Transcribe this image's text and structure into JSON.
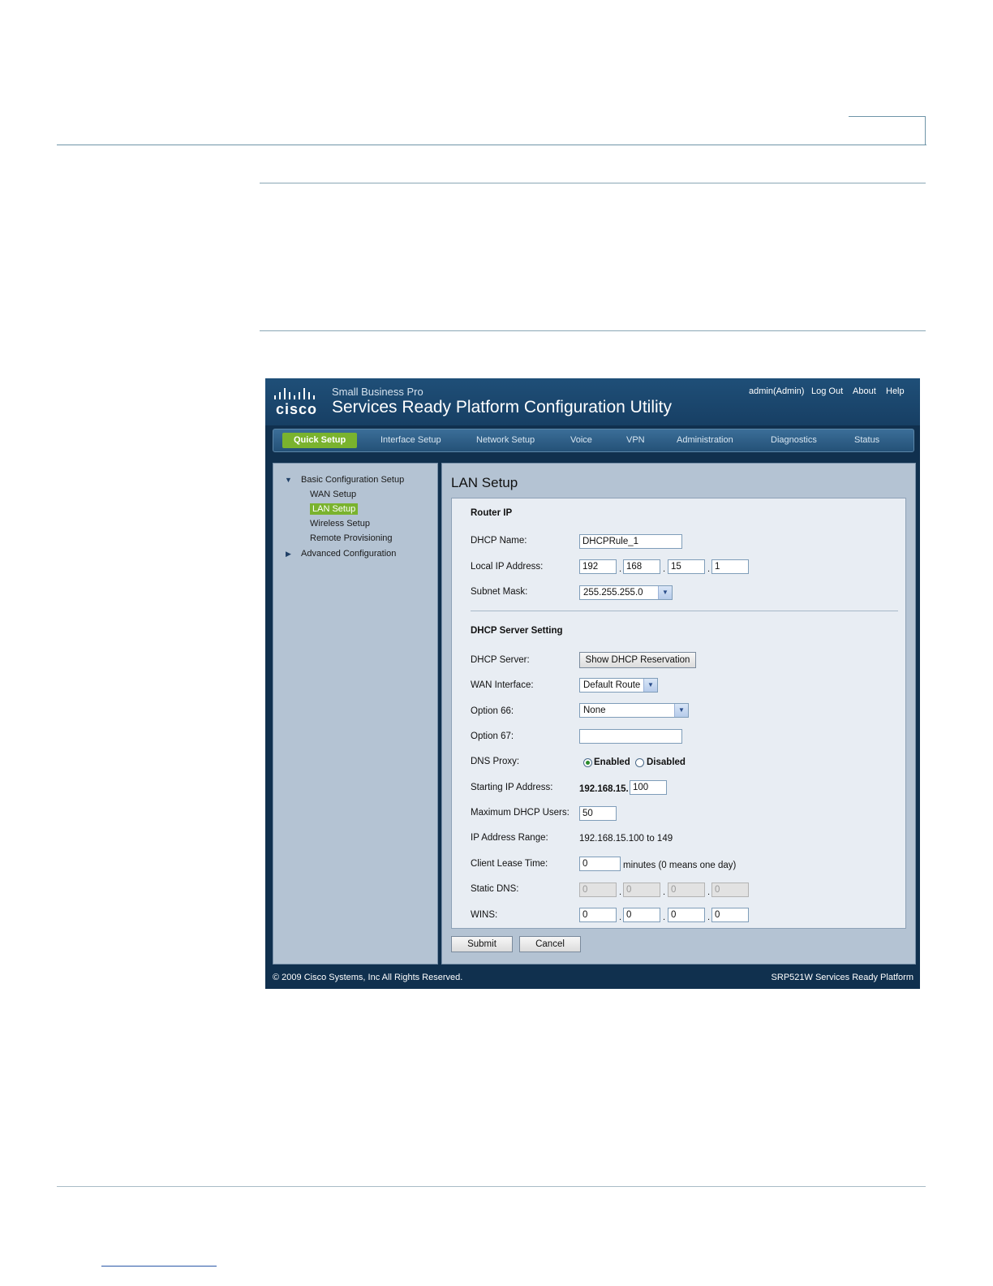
{
  "header_logo": "cisco",
  "header_subtitle": "Small Business Pro",
  "header_title": "Services Ready Platform Configuration Utility",
  "top_links": {
    "user": "admin(Admin)",
    "logout": "Log Out",
    "about": "About",
    "help": "Help"
  },
  "nav": [
    {
      "label": "Quick Setup",
      "active": true
    },
    {
      "label": "Interface Setup"
    },
    {
      "label": "Network Setup"
    },
    {
      "label": "Voice"
    },
    {
      "label": "VPN"
    },
    {
      "label": "Administration"
    },
    {
      "label": "Diagnostics"
    },
    {
      "label": "Status"
    }
  ],
  "sidebar": {
    "basic": "Basic Configuration Setup",
    "items": [
      "WAN Setup",
      "LAN Setup",
      "Wireless Setup",
      "Remote Provisioning"
    ],
    "advanced": "Advanced Configuration"
  },
  "page_title": "LAN Setup",
  "router_ip": {
    "heading": "Router IP",
    "dhcp_name_label": "DHCP Name:",
    "dhcp_name_value": "DHCPRule_1",
    "local_ip_label": "Local IP Address:",
    "local_ip": [
      "192",
      "168",
      "15",
      "1"
    ],
    "subnet_label": "Subnet Mask:",
    "subnet_value": "255.255.255.0"
  },
  "dhcp": {
    "heading": "DHCP Server Setting",
    "server_label": "DHCP Server:",
    "show_reservation_button": "Show DHCP Reservation",
    "wan_label": "WAN Interface:",
    "wan_value": "Default Route",
    "opt66_label": "Option 66:",
    "opt66_value": "None",
    "opt67_label": "Option 67:",
    "opt67_value": "",
    "dns_proxy_label": "DNS Proxy:",
    "dns_enabled": "Enabled",
    "dns_disabled": "Disabled",
    "start_ip_label": "Starting IP Address:",
    "start_ip_prefix": "192.168.15.",
    "start_ip_value": "100",
    "max_users_label": "Maximum DHCP Users:",
    "max_users_value": "50",
    "range_label": "IP Address Range:",
    "range_value": "192.168.15.100 to 149",
    "lease_label": "Client Lease Time:",
    "lease_value": "0",
    "lease_note": "minutes (0 means one day)",
    "static_dns_label": "Static DNS:",
    "static_dns": [
      "0",
      "0",
      "0",
      "0"
    ],
    "wins_label": "WINS:",
    "wins": [
      "0",
      "0",
      "0",
      "0"
    ]
  },
  "buttons": {
    "submit": "Submit",
    "cancel": "Cancel"
  },
  "footer": {
    "copyright": "© 2009 Cisco Systems, Inc All Rights Reserved.",
    "product": "SRP521W Services Ready Platform"
  },
  "colors": {
    "accent_green": "#7ab32e",
    "header_blue": "#1f4f78",
    "panel_gray": "#b4c3d3"
  }
}
